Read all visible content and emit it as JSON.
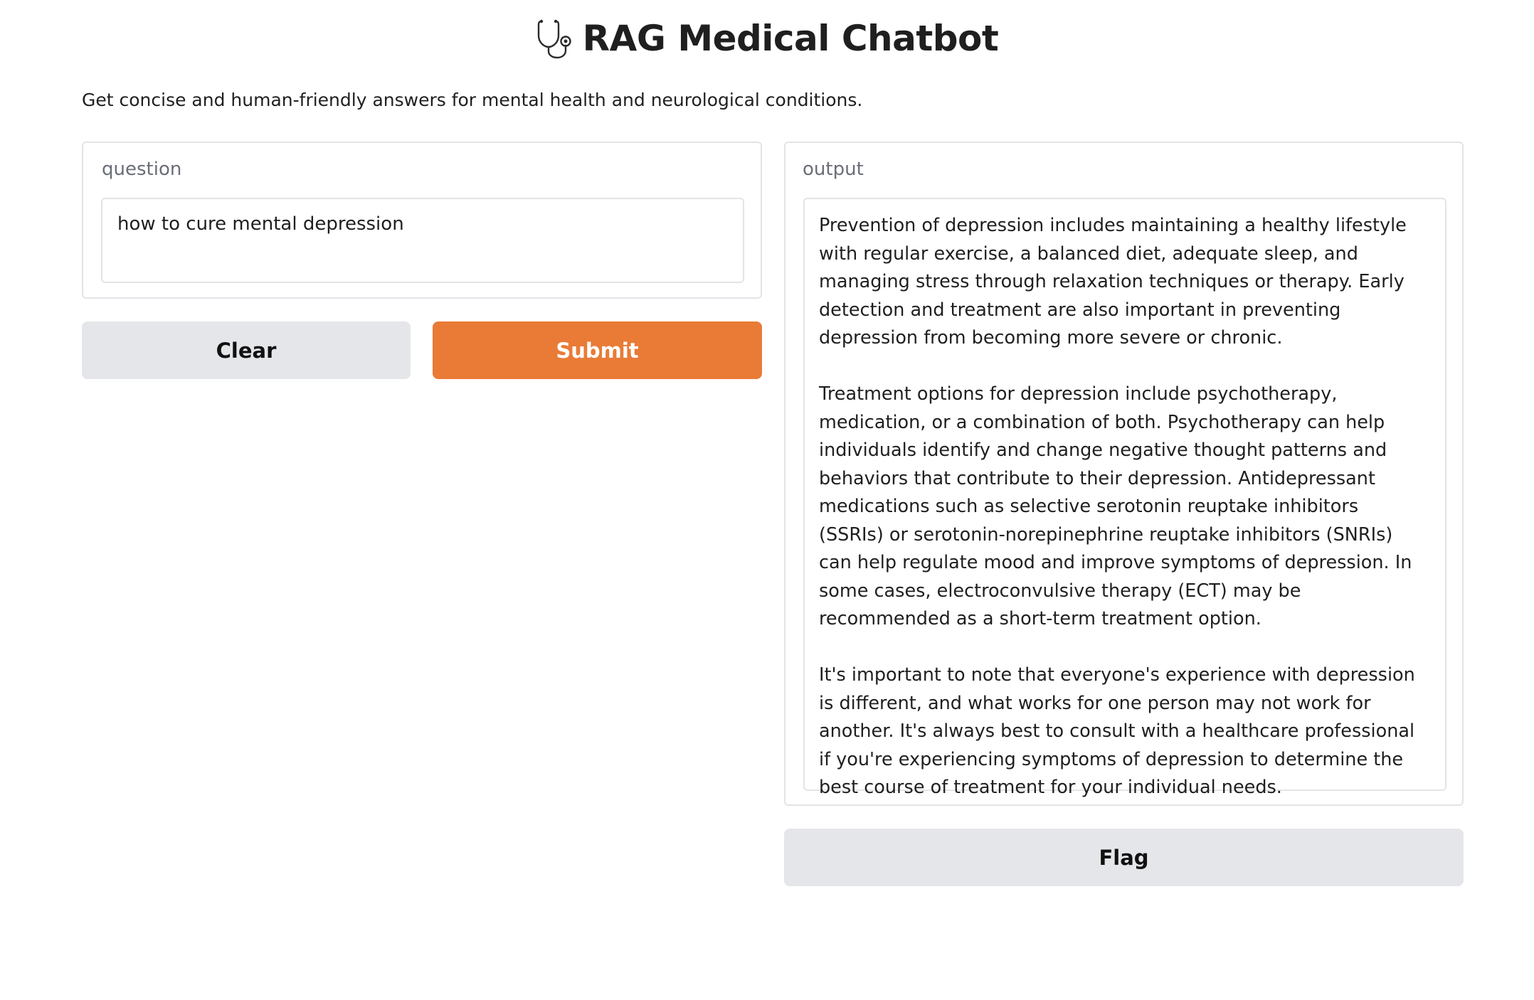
{
  "header": {
    "title": "RAG Medical Chatbot",
    "title_icon": "stethoscope-icon",
    "description": "Get concise and human-friendly answers for mental health and neurological conditions."
  },
  "input_panel": {
    "label": "question",
    "value": "how to cure mental depression"
  },
  "buttons": {
    "clear_label": "Clear",
    "submit_label": "Submit",
    "flag_label": "Flag"
  },
  "output_panel": {
    "label": "output",
    "paragraphs": [
      "Prevention of depression includes maintaining a healthy lifestyle with regular exercise, a balanced diet, adequate sleep, and managing stress through relaxation techniques or therapy. Early detection and treatment are also important in preventing depression from becoming more severe or chronic.",
      "Treatment options for depression include psychotherapy, medication, or a combination of both. Psychotherapy can help individuals identify and change negative thought patterns and behaviors that contribute to their depression. Antidepressant medications such as selective serotonin reuptake inhibitors (SSRIs) or serotonin-norepinephrine reuptake inhibitors (SNRIs) can help regulate mood and improve symptoms of depression. In some cases, electroconvulsive therapy (ECT) may be recommended as a short-term treatment option.",
      "It's important to note that everyone's experience with depression is different, and what works for one person may not work for another. It's always best to consult with a healthcare professional if you're experiencing symptoms of depression to determine the best course of treatment for your individual needs."
    ]
  },
  "colors": {
    "primary_button": "#e97b36",
    "secondary_button": "#e5e6e9",
    "border": "#e3e4e8",
    "label_text": "#6b6e78"
  }
}
